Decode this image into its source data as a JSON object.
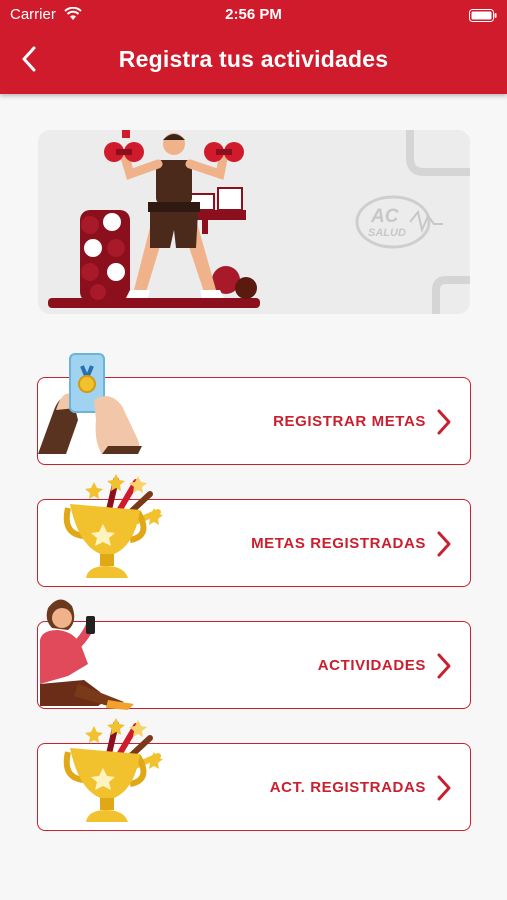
{
  "status_bar": {
    "carrier": "Carrier",
    "time": "2:56 PM",
    "icons": [
      "wifi-icon",
      "battery-icon"
    ]
  },
  "header": {
    "title": "Registra tus actividades",
    "back_icon": "chevron-left-icon"
  },
  "banner": {
    "logo_text": "AC SALUD",
    "illustration": "fitness-man-dumbbells"
  },
  "menu": {
    "items": [
      {
        "label": "REGISTRAR METAS",
        "icon": "phone-medal-icon"
      },
      {
        "label": "METAS REGISTRADAS",
        "icon": "trophy-icon"
      },
      {
        "label": "ACTIVIDADES",
        "icon": "person-phone-icon"
      },
      {
        "label": "ACT. REGISTRADAS",
        "icon": "trophy-icon"
      }
    ]
  },
  "colors": {
    "primary": "#cf1b2b",
    "background": "#f7f7f7",
    "card_border": "#c9202f",
    "trophy": "#f2c12e"
  }
}
